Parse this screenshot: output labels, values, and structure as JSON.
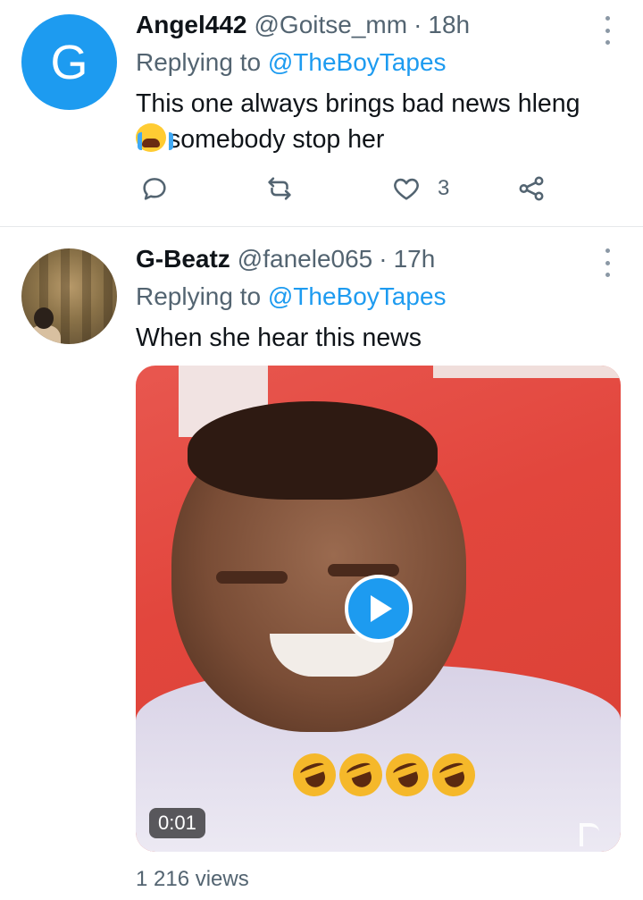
{
  "tweets": [
    {
      "avatar_letter": "G",
      "name": "Angel442",
      "handle": "@Goitse_mm",
      "separator": "·",
      "time": "18h",
      "replying_prefix": "Replying to",
      "replying_to": "@TheBoyTapes",
      "text_line1": "This one always brings bad news hleng",
      "text_line2": "somebody stop her",
      "emoji": "crying-face",
      "like_count": "3"
    },
    {
      "name": "G-Beatz",
      "handle": "@fanele065",
      "separator": "·",
      "time": "17h",
      "replying_prefix": "Replying to",
      "replying_to": "@TheBoyTapes",
      "text": "When she hear this news",
      "video": {
        "duration": "0:01",
        "overlay_emojis": [
          "laughing-face",
          "laughing-face",
          "laughing-face",
          "laughing-face"
        ]
      },
      "views": "1 216 views"
    }
  ],
  "colors": {
    "accent": "#1d9bf0",
    "muted": "#536471",
    "text": "#0f1419",
    "divider": "#e6e9eb"
  }
}
